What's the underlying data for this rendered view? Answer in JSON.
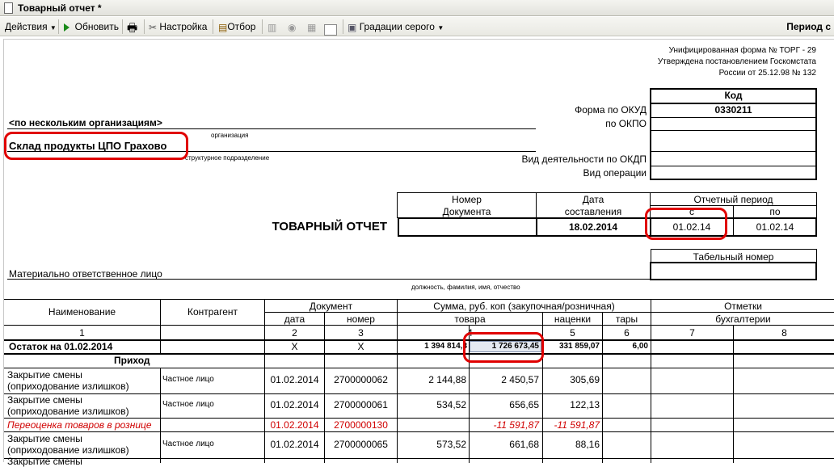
{
  "window": {
    "title": "Товарный отчет *"
  },
  "toolbar": {
    "actions": "Действия",
    "refresh": "Обновить",
    "settings": "Настройка",
    "filter": "Отбор",
    "grayscale": "Градации серого",
    "period": "Период с"
  },
  "header": {
    "form_line1": "Унифицированная форма № ТОРГ - 29",
    "form_line2": "Утверждена постановлением Госкомстата",
    "form_line3": "России от 25.12.98 № 132",
    "code_header": "Код",
    "okud_label": "Форма по ОКУД",
    "okud_value": "0330211",
    "okpo_label": "по ОКПО",
    "okdp_label": "Вид деятельности по ОКДП",
    "operation_label": "Вид операции",
    "organization": "<по нескольким организациям>",
    "organization_caption": "организация",
    "division": "Склад продукты ЦПО Грахово",
    "division_caption": "структурное подразделение"
  },
  "doc_block": {
    "number_header_1": "Номер",
    "number_header_2": "Документа",
    "date_header_1": "Дата",
    "date_header_2": "составления",
    "period_header": "Отчетный период",
    "from_header": "с",
    "to_header": "по",
    "title": "ТОВАРНЫЙ ОТЧЕТ",
    "date_value": "18.02.2014",
    "from_value": "01.02.14",
    "to_value": "01.02.14",
    "tab_number_header": "Табельный номер",
    "responsible_label": "Материально ответственное лицо",
    "responsible_caption": "должность, фамилия, имя, отчество"
  },
  "table": {
    "h_name": "Наименование",
    "h_contractor": "Контрагент",
    "h_document": "Документ",
    "h_date": "дата",
    "h_number": "номер",
    "h_sum": "Сумма, руб. коп (закупочная/розничная)",
    "h_goods": "товара",
    "h_markup": "наценки",
    "h_tare": "тары",
    "h_marks_1": "Отметки",
    "h_marks_2": "бухгалтерии",
    "n1": "1",
    "n2": "2",
    "n3": "3",
    "n4": "4",
    "n5": "5",
    "n6": "6",
    "n7": "7",
    "n8": "8",
    "balance": {
      "name": "Остаток на 01.02.2014",
      "date": "Х",
      "number": "Х",
      "purchase": "1 394 814,3",
      "retail": "1 726 673,45",
      "markup": "331 859,07",
      "tare": "6,00"
    },
    "income_label": "Приход",
    "rows": [
      {
        "name1": "Закрытие смены",
        "name2": "(оприходование излишков)",
        "contractor": "Частное лицо",
        "date": "01.02.2014",
        "number": "2700000062",
        "purchase": "2 144,88",
        "retail": "2 450,57",
        "markup": "305,69"
      },
      {
        "name1": "Закрытие смены",
        "name2": "(оприходование излишков)",
        "contractor": "Частное лицо",
        "date": "01.02.2014",
        "number": "2700000061",
        "purchase": "534,52",
        "retail": "656,65",
        "markup": "122,13"
      },
      {
        "name1": "Переоценка товаров в рознице",
        "date": "01.02.2014",
        "number": "2700000130",
        "retail": "-11 591,87",
        "markup": "-11 591,87"
      },
      {
        "name1": "Закрытие смены",
        "name2": "(оприходование излишков)",
        "contractor": "Частное лицо",
        "date": "01.02.2014",
        "number": "2700000065",
        "purchase": "573,52",
        "retail": "661,68",
        "markup": "88,16"
      },
      {
        "name1": "Закрытие смены"
      }
    ]
  }
}
